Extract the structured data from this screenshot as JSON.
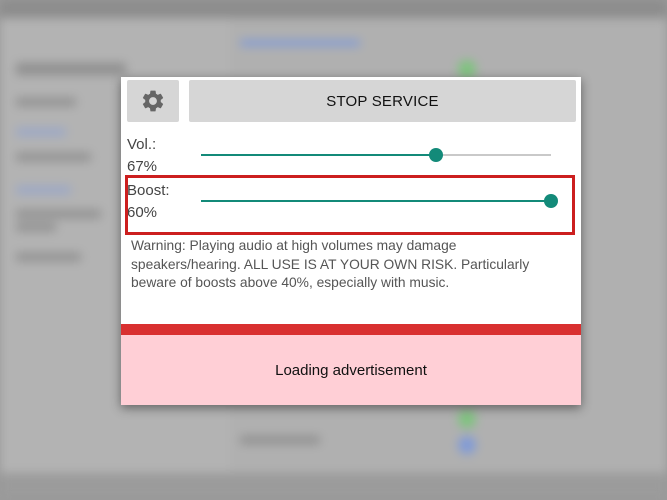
{
  "dialog": {
    "settings_icon": "gear-icon",
    "stop_label": "STOP SERVICE",
    "volume": {
      "label": "Vol.:",
      "value_text": "67%",
      "level": 0.67
    },
    "boost": {
      "label": "Boost:",
      "value_text": "60%",
      "level": 1.0
    },
    "warning": "Warning: Playing audio at high volumes may damage speakers/hearing. ALL USE IS AT YOUR OWN RISK. Particularly beware of boosts above 40%, especially with music.",
    "ad_text": "Loading advertisement"
  },
  "colors": {
    "accent": "#138a79",
    "highlight_border": "#cc1f1f",
    "ad_bar": "#d93030",
    "ad_background": "#ffcfd6"
  }
}
